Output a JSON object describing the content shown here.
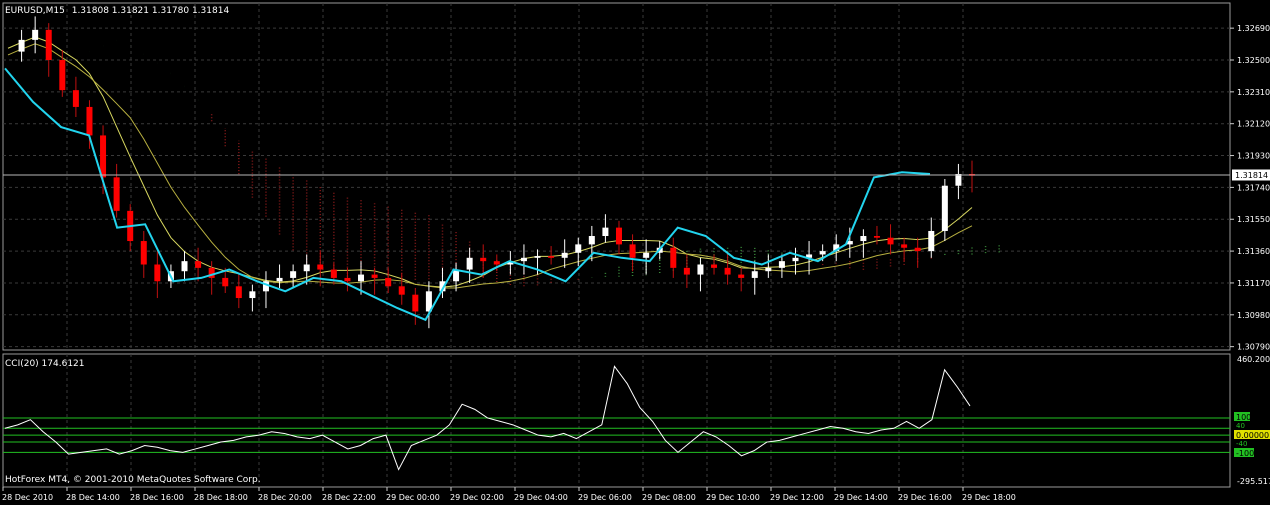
{
  "header": {
    "symbol": "EURUSD,M15",
    "ohlc": "1.31808 1.31821 1.31780 1.31814"
  },
  "indicator": {
    "label": "CCI(20) 174.6121",
    "scale_top": "460.2000",
    "scale_bottom": "-295.5175",
    "level_100": "100",
    "level_40": "40",
    "level_zero": "0.00000",
    "level_m40": "-40",
    "level_m100": "-100"
  },
  "footer": {
    "copyright": "HotForex MT4, © 2001-2010 MetaQuotes Software Corp."
  },
  "current_price": "1.31814",
  "colors": {
    "background": "#000000",
    "grid": "#3a3a3a",
    "bull_candle": "#ffffff",
    "bear_candle": "#ff0000",
    "cyan_line": "#22d4ee",
    "yellow_line": "#d8d860",
    "green_cloud": "#3a8a3a",
    "red_cloud": "#8a1a1a",
    "cci_line": "#ffffff",
    "cci_levels": "#22c022",
    "level_box": "#22c022",
    "zero_box": "#e0e000",
    "price_box": "#ffffff"
  },
  "chart_data": {
    "type": "candlestick",
    "title": "EURUSD,M15",
    "y_ticks": [
      "1.32690",
      "1.32500",
      "1.32310",
      "1.32120",
      "1.31930",
      "1.31740",
      "1.31550",
      "1.31360",
      "1.31170",
      "1.30980",
      "1.30790"
    ],
    "y_tick_values": [
      1.3269,
      1.325,
      1.3231,
      1.3212,
      1.3193,
      1.3174,
      1.3155,
      1.3136,
      1.3117,
      1.3098,
      1.3079
    ],
    "ylim": [
      1.3077,
      1.3284
    ],
    "x_ticks": [
      "28 Dec 2010",
      "28 Dec 14:00",
      "28 Dec 16:00",
      "28 Dec 18:00",
      "28 Dec 20:00",
      "28 Dec 22:00",
      "29 Dec 00:00",
      "29 Dec 02:00",
      "29 Dec 04:00",
      "29 Dec 06:00",
      "29 Dec 08:00",
      "29 Dec 10:00",
      "29 Dec 12:00",
      "29 Dec 14:00",
      "29 Dec 16:00",
      "29 Dec 18:00"
    ],
    "close_path": [
      1.3255,
      1.3262,
      1.3268,
      1.325,
      1.3232,
      1.3222,
      1.3205,
      1.318,
      1.316,
      1.3142,
      1.3128,
      1.3118,
      1.3124,
      1.313,
      1.3126,
      1.312,
      1.3115,
      1.3108,
      1.3112,
      1.3118,
      1.312,
      1.3124,
      1.3128,
      1.3125,
      1.312,
      1.3118,
      1.3122,
      1.312,
      1.3115,
      1.311,
      1.31,
      1.3112,
      1.3118,
      1.3125,
      1.3132,
      1.313,
      1.3128,
      1.313,
      1.3132,
      1.3133,
      1.3132,
      1.3135,
      1.314,
      1.3145,
      1.315,
      1.314,
      1.3132,
      1.3135,
      1.3138,
      1.3126,
      1.3122,
      1.3128,
      1.3126,
      1.3122,
      1.312,
      1.3124,
      1.3126,
      1.313,
      1.3132,
      1.3134,
      1.3136,
      1.314,
      1.3142,
      1.3145,
      1.3144,
      1.314,
      1.3138,
      1.3136,
      1.3148,
      1.3175,
      1.3182,
      1.3181
    ],
    "cyan_line": [
      1.3245,
      1.3225,
      1.321,
      1.3205,
      1.315,
      1.3152,
      1.3118,
      1.312,
      1.3125,
      1.3118,
      1.3112,
      1.312,
      1.3118,
      1.311,
      1.3102,
      1.3095,
      1.3125,
      1.3122,
      1.313,
      1.3125,
      1.3118,
      1.3135,
      1.3132,
      1.313,
      1.315,
      1.3145,
      1.3132,
      1.3128,
      1.3135,
      1.313,
      1.314,
      1.318,
      1.3183,
      1.3182
    ],
    "cci": {
      "ylim": [
        -295.5175,
        460.2
      ],
      "levels": [
        100,
        40,
        0,
        -40,
        -100
      ],
      "values": [
        40,
        60,
        90,
        20,
        -40,
        -110,
        -100,
        -90,
        -80,
        -110,
        -90,
        -60,
        -70,
        -90,
        -100,
        -80,
        -60,
        -40,
        -30,
        -10,
        0,
        20,
        10,
        -10,
        -20,
        0,
        -40,
        -80,
        -60,
        -20,
        0,
        -200,
        -60,
        -30,
        0,
        60,
        180,
        150,
        100,
        80,
        60,
        30,
        0,
        -10,
        10,
        -20,
        20,
        60,
        400,
        300,
        160,
        80,
        -30,
        -100,
        -40,
        20,
        -10,
        -60,
        -120,
        -90,
        -40,
        -30,
        -10,
        10,
        30,
        50,
        40,
        20,
        10,
        30,
        40,
        80,
        40,
        90,
        380,
        280,
        170
      ]
    }
  }
}
